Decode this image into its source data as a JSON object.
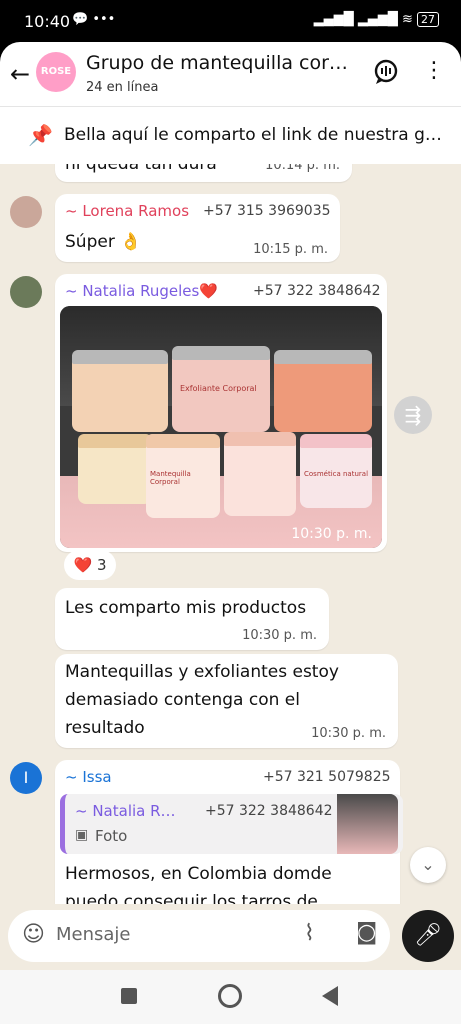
{
  "status_bar": {
    "time": "10:40",
    "battery": "27"
  },
  "header": {
    "title": "Grupo de mantequilla cor…",
    "subtitle": "24 en línea",
    "avatar_text": "ROSE"
  },
  "pinned": {
    "text": "Bella aquí le comparto el link de nuestra g…"
  },
  "messages": [
    {
      "text": "ni queda tan dura",
      "time": "10:14 p. m."
    },
    {
      "sender": "~ Lorena Ramos",
      "phone": "+57 315 3969035",
      "text": "Súper 👌",
      "time": "10:15 p. m."
    },
    {
      "sender": "~ Natalia Rugeles❤️",
      "phone": "+57 322 3848642",
      "time": "10:30 p. m.",
      "reaction": "❤️",
      "reaction_count": "3"
    },
    {
      "text": "Les comparto mis productos",
      "time": "10:30 p. m."
    },
    {
      "text": "Mantequillas y exfoliantes estoy demasiado contenga con el resultado",
      "time": "10:30 p. m."
    },
    {
      "sender": "~ Issa",
      "phone": "+57 321 5079825",
      "avatar_initial": "I",
      "quote": {
        "sender": "~ Natalia R…",
        "phone": "+57 322 3848642",
        "label": "Foto"
      },
      "text": "Hermosos, en Colombia domde puedo conseguir los tarros de"
    }
  ],
  "photo_labels": [
    "Exfoliante Corporal",
    "Mantequilla Corporal",
    "Cosmética natural"
  ],
  "input": {
    "placeholder": "Mensaje"
  },
  "colors": {
    "lorena": "#e0415b",
    "natalia": "#7a5be0",
    "issa": "#1a73d6",
    "accent": "#9b6fe0"
  }
}
